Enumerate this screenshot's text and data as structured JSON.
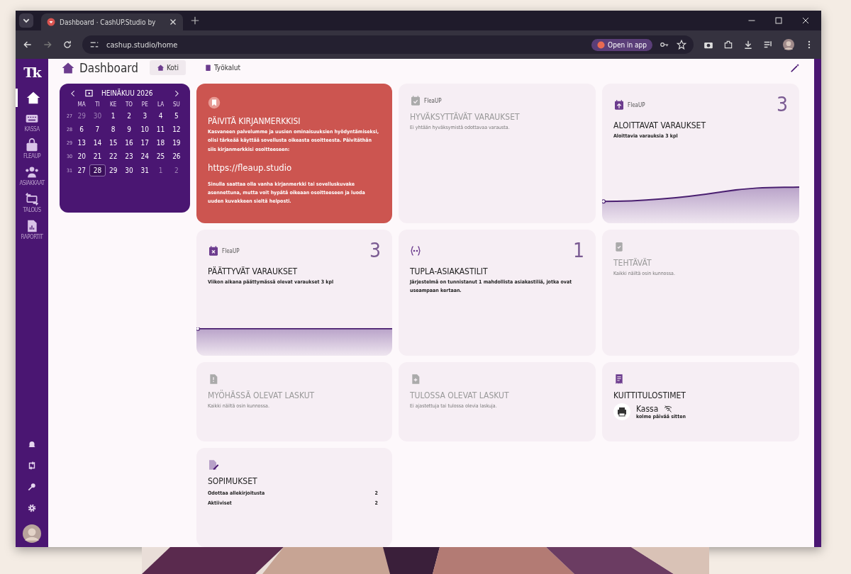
{
  "browser": {
    "tab_title": "Dashboard · CashUP.Studio by",
    "url": "cashup.studio/home",
    "open_in_app": "Open in app"
  },
  "sidebar": {
    "logo": "Tk",
    "items": [
      {
        "selected": true
      },
      {
        "label": "KASSA",
        "selected": false
      },
      {
        "label": "FLEAUP",
        "selected": false
      },
      {
        "label": "ASIAKKAAT",
        "selected": false
      },
      {
        "label": "TALOUS",
        "selected": false
      },
      {
        "label": "RAPORTIT",
        "selected": false
      }
    ]
  },
  "header": {
    "title": "Dashboard",
    "tabs": [
      {
        "label": "Koti",
        "selected": true
      },
      {
        "label": "Työkalut",
        "selected": false
      }
    ]
  },
  "calendar": {
    "month": "HEINÄKUU 2026",
    "weekdays": [
      "MA",
      "TI",
      "KE",
      "TO",
      "PE",
      "LA",
      "SU"
    ],
    "weeks": [
      {
        "number": "27",
        "days": [
          {
            "day": "29",
            "outside": true,
            "selected": false
          },
          {
            "day": "30",
            "outside": true,
            "selected": false
          },
          {
            "day": "1",
            "outside": false,
            "selected": false
          },
          {
            "day": "2",
            "outside": false,
            "selected": false
          },
          {
            "day": "3",
            "outside": false,
            "selected": false
          },
          {
            "day": "4",
            "outside": false,
            "selected": false
          },
          {
            "day": "5",
            "outside": false,
            "selected": false
          }
        ]
      },
      {
        "number": "28",
        "days": [
          {
            "day": "6",
            "outside": false,
            "selected": false
          },
          {
            "day": "7",
            "outside": false,
            "selected": false
          },
          {
            "day": "8",
            "outside": false,
            "selected": false
          },
          {
            "day": "9",
            "outside": false,
            "selected": false
          },
          {
            "day": "10",
            "outside": false,
            "selected": false
          },
          {
            "day": "11",
            "outside": false,
            "selected": false
          },
          {
            "day": "12",
            "outside": false,
            "selected": false
          }
        ]
      },
      {
        "number": "29",
        "days": [
          {
            "day": "13",
            "outside": false,
            "selected": false
          },
          {
            "day": "14",
            "outside": false,
            "selected": false
          },
          {
            "day": "15",
            "outside": false,
            "selected": false
          },
          {
            "day": "16",
            "outside": false,
            "selected": false
          },
          {
            "day": "17",
            "outside": false,
            "selected": false
          },
          {
            "day": "18",
            "outside": false,
            "selected": false
          },
          {
            "day": "19",
            "outside": false,
            "selected": false
          }
        ]
      },
      {
        "number": "30",
        "days": [
          {
            "day": "20",
            "outside": false,
            "selected": false
          },
          {
            "day": "21",
            "outside": false,
            "selected": false
          },
          {
            "day": "22",
            "outside": false,
            "selected": false
          },
          {
            "day": "23",
            "outside": false,
            "selected": false
          },
          {
            "day": "24",
            "outside": false,
            "selected": false
          },
          {
            "day": "25",
            "outside": false,
            "selected": false
          },
          {
            "day": "26",
            "outside": false,
            "selected": false
          }
        ]
      },
      {
        "number": "31",
        "days": [
          {
            "day": "27",
            "outside": false,
            "selected": false
          },
          {
            "day": "28",
            "outside": false,
            "selected": true
          },
          {
            "day": "29",
            "outside": false,
            "selected": false
          },
          {
            "day": "30",
            "outside": false,
            "selected": false
          },
          {
            "day": "31",
            "outside": false,
            "selected": false
          },
          {
            "day": "1",
            "outside": true,
            "selected": false
          },
          {
            "day": "2",
            "outside": true,
            "selected": false
          }
        ]
      }
    ]
  },
  "cards": [
    {
      "kind": "alert",
      "title": "PÄIVITÄ KIRJANMERKKISI",
      "text": "Kasvaneen palvelumme ja uusien ominaisuuksien hyödyntämiseksi, olisi tärkeää käyttää sovellusta oikeasta osoitteesta. Päivitäthän siis kirjanmerkkisi osoitteeseen:",
      "link": "https://fleaup.studio",
      "note": "Sinulla saattaa olla vanha kirjanmerkki tai sovelluskuvake asennettuna, mutta voit hypätä oikeaan osoitteeseen ja luoda uuden kuvakkeen sieltä helposti."
    },
    {
      "kind": "plain",
      "tag": "FleaUP",
      "title": "HYVÄKSYTTÄVÄT VARAUKSET",
      "text": "Ei yhtään hyväksymistä odottavaa varausta.",
      "muted": true
    },
    {
      "kind": "chart",
      "tag": "FleaUP",
      "count": "3",
      "title": "ALOITTAVAT VARAUKSET",
      "text": "Aloittavia varauksia 3 kpl",
      "muted": false
    },
    {
      "kind": "chart",
      "tag": "FleaUP",
      "count": "3",
      "title": "PÄÄTTYVÄT VARAUKSET",
      "text": "Viikon aikana päättymässä olevat varaukset 3 kpl",
      "muted": false
    },
    {
      "kind": "plain",
      "count": "1",
      "title": "TUPLA-ASIAKASTILIT",
      "text": "Järjestelmä on tunnistanut 1 mahdollista asiakastiliä, jotka ovat useampaan kertaan.",
      "muted": false
    },
    {
      "kind": "plain",
      "title": "TEHTÄVÄT",
      "text": "Kaikki näiltä osin kunnossa.",
      "muted": true
    },
    {
      "kind": "plain",
      "title": "MYÖHÄSSÄ OLEVAT LASKUT",
      "text": "Kaikki näiltä osin kunnossa.",
      "muted": true
    },
    {
      "kind": "plain",
      "title": "TULOSSA OLEVAT LASKUT",
      "text": "Ei ajastettuja tai tulossa olevia laskuja.",
      "muted": true
    },
    {
      "kind": "printers",
      "title": "KUITTITULOSTIMET",
      "printers": [
        {
          "name": "Kassa",
          "seen": "kolme päivää sitten",
          "online": false
        }
      ]
    },
    {
      "kind": "list",
      "title": "SOPIMUKSET",
      "rows": [
        {
          "label": "Odottaa allekirjoitusta",
          "value": "2"
        },
        {
          "label": "Aktiiviset",
          "value": "2"
        }
      ]
    }
  ]
}
